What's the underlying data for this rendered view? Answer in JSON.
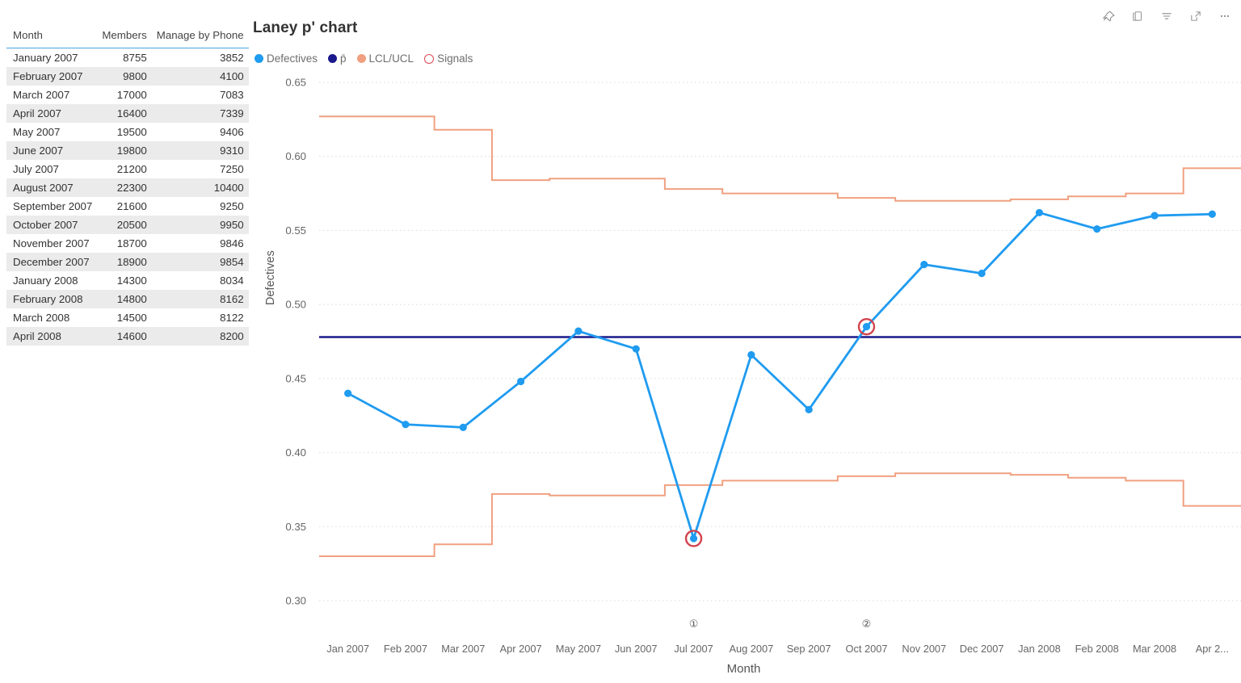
{
  "toolbar": {
    "buttons": [
      {
        "name": "pin-icon",
        "label": "Pin to dashboard"
      },
      {
        "name": "copy-icon",
        "label": "Copy visual"
      },
      {
        "name": "filter-icon",
        "label": "Filters"
      },
      {
        "name": "focus-mode-icon",
        "label": "Focus mode"
      },
      {
        "name": "more-options-icon",
        "label": "More options"
      }
    ]
  },
  "table": {
    "columns": [
      "Month",
      "Members",
      "Manage by Phone"
    ],
    "rows": [
      [
        "January 2007",
        "8755",
        "3852"
      ],
      [
        "February 2007",
        "9800",
        "4100"
      ],
      [
        "March 2007",
        "17000",
        "7083"
      ],
      [
        "April 2007",
        "16400",
        "7339"
      ],
      [
        "May 2007",
        "19500",
        "9406"
      ],
      [
        "June 2007",
        "19800",
        "9310"
      ],
      [
        "July 2007",
        "21200",
        "7250"
      ],
      [
        "August 2007",
        "22300",
        "10400"
      ],
      [
        "September 2007",
        "21600",
        "9250"
      ],
      [
        "October 2007",
        "20500",
        "9950"
      ],
      [
        "November 2007",
        "18700",
        "9846"
      ],
      [
        "December 2007",
        "18900",
        "9854"
      ],
      [
        "January 2008",
        "14300",
        "8034"
      ],
      [
        "February 2008",
        "14800",
        "8162"
      ],
      [
        "March 2008",
        "14500",
        "8122"
      ],
      [
        "April 2008",
        "14600",
        "8200"
      ]
    ]
  },
  "chart": {
    "title": "Laney p' chart",
    "legend": [
      {
        "label": "Defectives",
        "color": "#1f9bf0",
        "marker": "dot"
      },
      {
        "label": "p̄",
        "color": "#1a1a8c",
        "marker": "dot"
      },
      {
        "label": "LCL/UCL",
        "color": "#f0a080",
        "marker": "dot"
      },
      {
        "label": "Signals",
        "color": "#d94a52",
        "marker": "ring"
      }
    ]
  },
  "chart_data": {
    "type": "line",
    "title": "Laney p' chart",
    "xlabel": "Month",
    "ylabel": "Defectives",
    "ylim": [
      0.3,
      0.65
    ],
    "yticks": [
      "0.30",
      "0.35",
      "0.40",
      "0.45",
      "0.50",
      "0.55",
      "0.60",
      "0.65"
    ],
    "ytick_values": [
      0.3,
      0.35,
      0.4,
      0.45,
      0.5,
      0.55,
      0.6,
      0.65
    ],
    "grid": "horizontal-dotted",
    "legend_position": "top-left",
    "categories": [
      "Jan 2007",
      "Feb 2007",
      "Mar 2007",
      "Apr 2007",
      "May 2007",
      "Jun 2007",
      "Jul 2007",
      "Aug 2007",
      "Sep 2007",
      "Oct 2007",
      "Nov 2007",
      "Dec 2007",
      "Jan 2008",
      "Feb 2008",
      "Mar 2008",
      "Apr 2..."
    ],
    "series": [
      {
        "name": "Defectives",
        "color": "#1f9bf0",
        "type": "line-marker",
        "values": [
          0.44,
          0.419,
          0.417,
          0.448,
          0.482,
          0.47,
          0.342,
          0.466,
          0.429,
          0.485,
          0.527,
          0.521,
          0.562,
          0.551,
          0.56,
          0.561
        ]
      },
      {
        "name": "p̄",
        "color": "#1a1a8c",
        "type": "constant-line",
        "value": 0.478
      },
      {
        "name": "UCL",
        "color": "#f0a080",
        "type": "step",
        "values": [
          0.627,
          0.627,
          0.618,
          0.584,
          0.585,
          0.585,
          0.578,
          0.575,
          0.575,
          0.572,
          0.57,
          0.57,
          0.571,
          0.573,
          0.575,
          0.592
        ]
      },
      {
        "name": "LCL",
        "color": "#f0a080",
        "type": "step",
        "values": [
          0.33,
          0.33,
          0.338,
          0.372,
          0.371,
          0.371,
          0.378,
          0.381,
          0.381,
          0.384,
          0.386,
          0.386,
          0.385,
          0.383,
          0.381,
          0.364
        ]
      }
    ],
    "signals": [
      {
        "index": 6,
        "label": "①",
        "category": "Jul 2007",
        "value": 0.342
      },
      {
        "index": 9,
        "label": "②",
        "category": "Oct 2007",
        "value": 0.485
      }
    ]
  }
}
